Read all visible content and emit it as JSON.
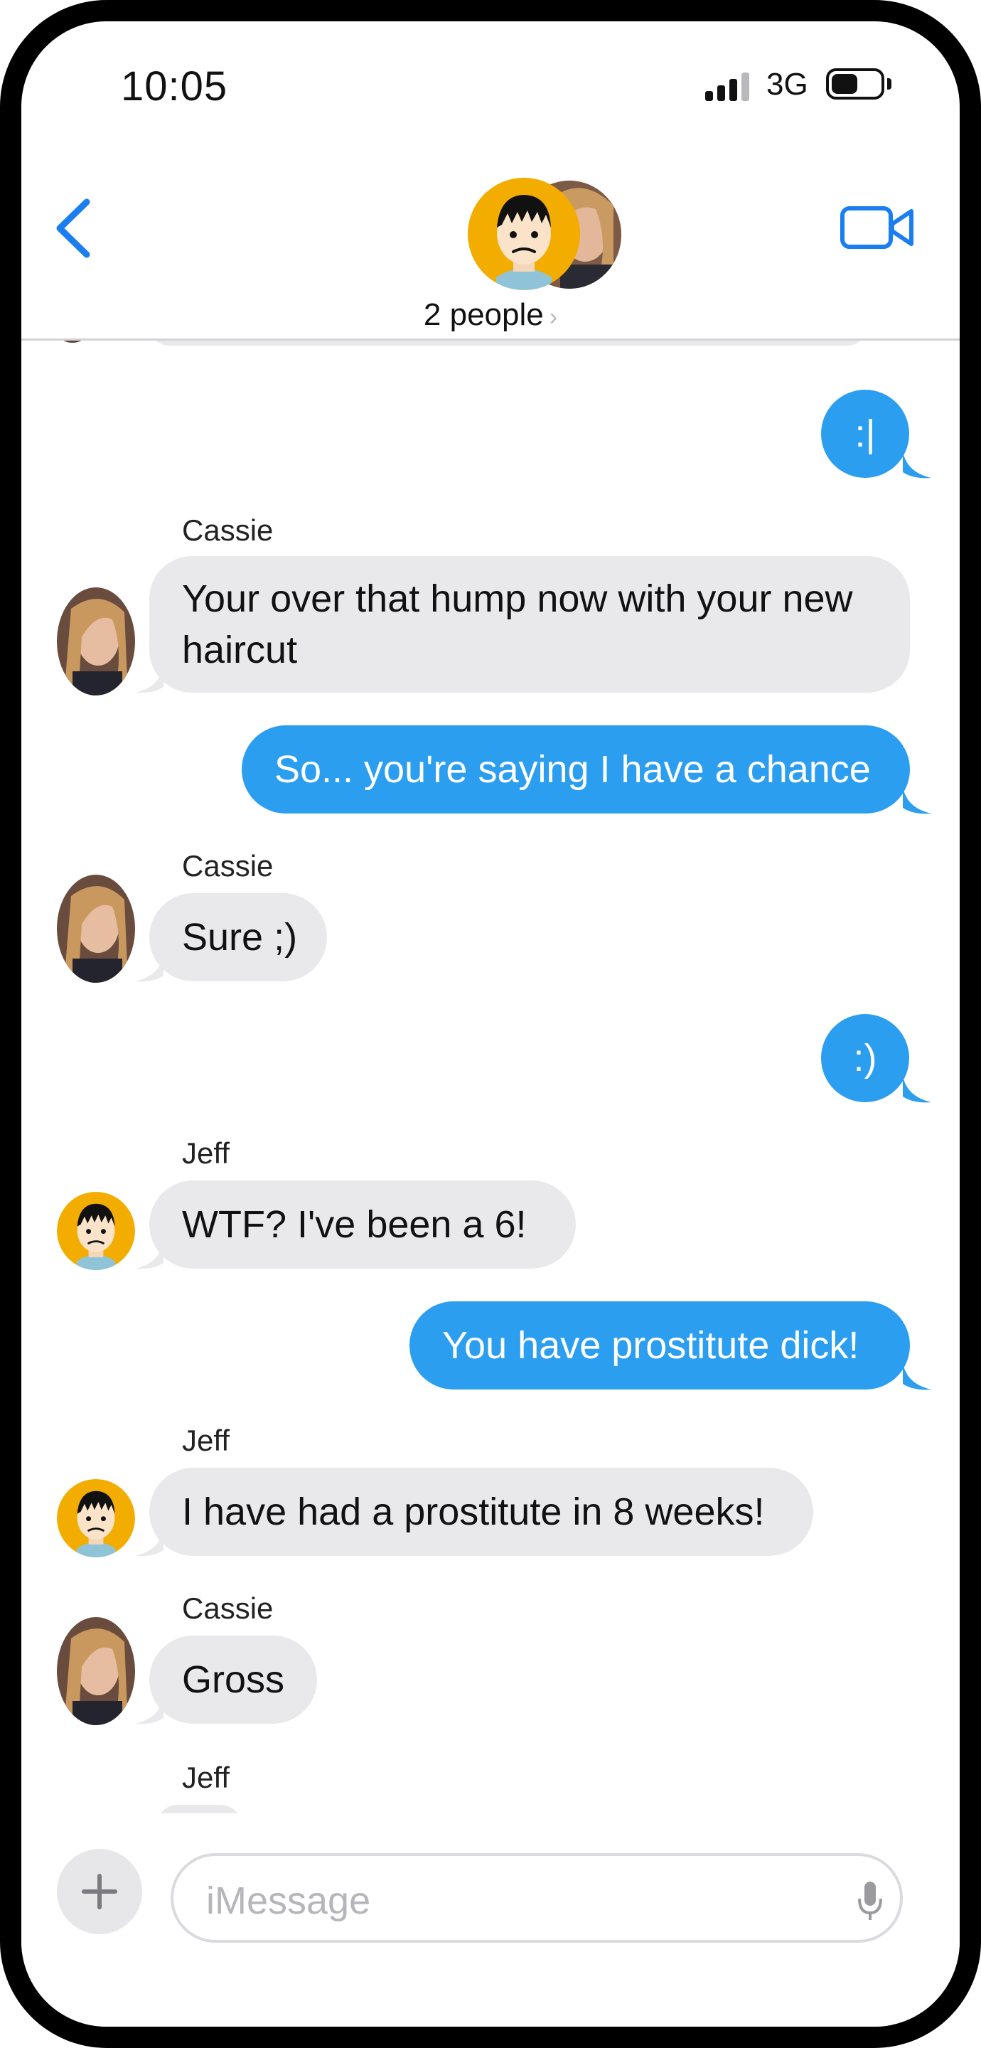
{
  "status_bar": {
    "time": "10:05",
    "carrier": "3G"
  },
  "header": {
    "group_label": "2 people",
    "chevron": "›",
    "back_icon": "chevron-left-icon",
    "video_icon": "video-camera-icon"
  },
  "messages": [
    {
      "from": "me",
      "text": ":|"
    },
    {
      "from": "Cassie",
      "sender_label": "Cassie",
      "lines": [
        "Your over that hump now with your new",
        "haircut"
      ]
    },
    {
      "from": "me",
      "text": "So... you're saying I have a chance"
    },
    {
      "from": "Cassie",
      "sender_label": "Cassie",
      "text": "Sure ;)"
    },
    {
      "from": "me",
      "text": ":)"
    },
    {
      "from": "Jeff",
      "sender_label": "Jeff",
      "text": "WTF?  I've been a 6!"
    },
    {
      "from": "me",
      "text": "You have prostitute dick!"
    },
    {
      "from": "Jeff",
      "sender_label": "Jeff",
      "text": "I have had a prostitute in 8 weeks!"
    },
    {
      "from": "Cassie",
      "sender_label": "Cassie",
      "text": "Gross"
    },
    {
      "from": "Jeff",
      "sender_label": "Jeff"
    }
  ],
  "composer": {
    "placeholder": "iMessage",
    "plus_icon": "plus-icon",
    "mic_icon": "microphone-icon"
  },
  "colors": {
    "outgoing": "#2c9ef0",
    "incoming": "#e9e9eb",
    "accent": "#1a7ef0"
  }
}
